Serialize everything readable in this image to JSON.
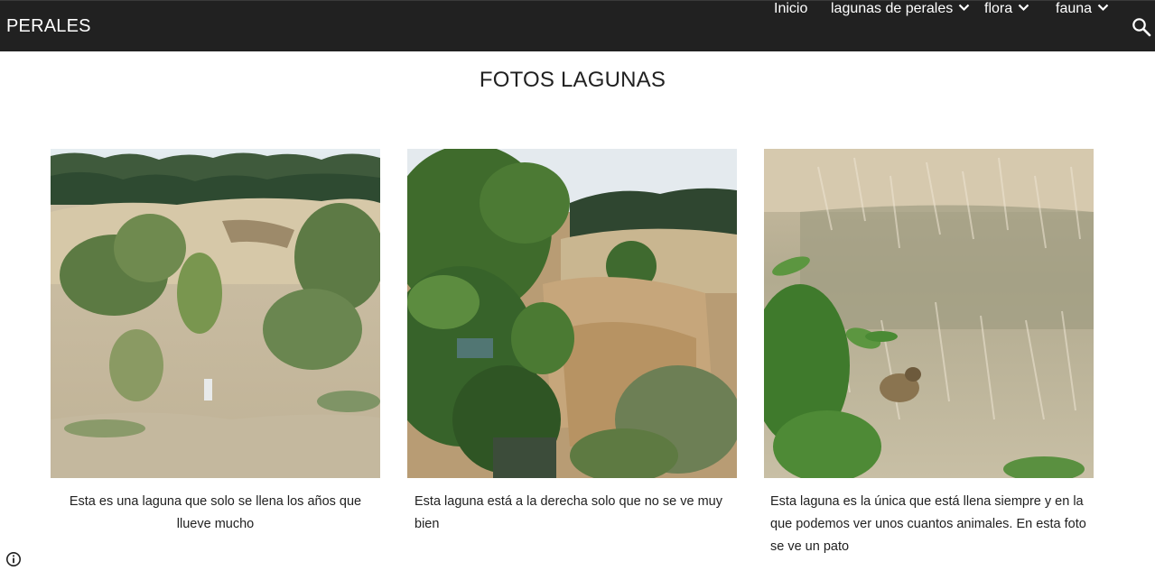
{
  "header": {
    "site_title": "PERALES",
    "nav": [
      {
        "label": "Inicio",
        "has_dropdown": false
      },
      {
        "label": "lagunas de perales",
        "has_dropdown": true
      },
      {
        "label": "flora",
        "has_dropdown": true
      },
      {
        "label": "fauna",
        "has_dropdown": true
      }
    ],
    "search_icon": "search-icon",
    "background": "#212121"
  },
  "main": {
    "title": "FOTOS LAGUNAS",
    "photos": [
      {
        "icon": "photo-laguna-seca",
        "caption": "Esta es una laguna que solo se llena los años que llueve mucho"
      },
      {
        "icon": "photo-laguna-derecha",
        "caption": "Esta laguna está a la derecha solo que no se ve muy bien"
      },
      {
        "icon": "photo-laguna-pato",
        "caption": "Esta laguna es la única que está llena siempre y en la que podemos ver unos cuantos animales. En esta foto se ve un pato"
      }
    ]
  },
  "footer": {
    "info_icon": "info-icon"
  }
}
